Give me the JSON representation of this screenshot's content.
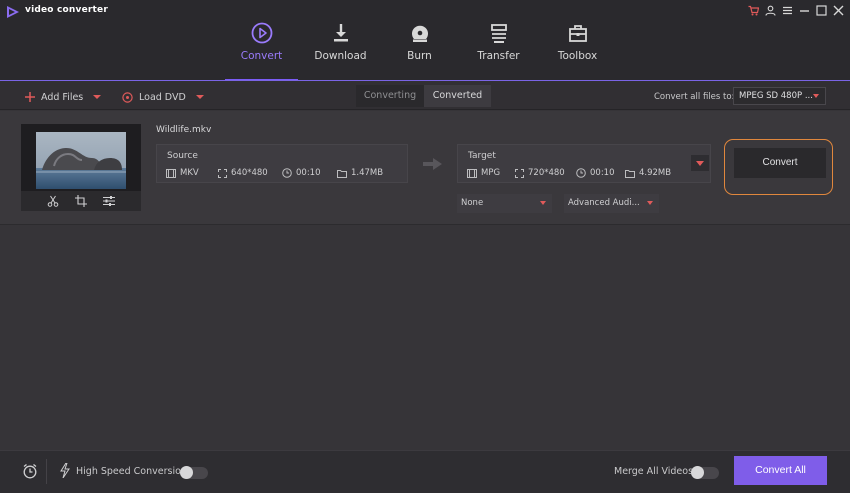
{
  "app": {
    "title": "video converter"
  },
  "nav": {
    "tabs": [
      {
        "label": "Convert",
        "icon": "play-circle-icon",
        "active": true
      },
      {
        "label": "Download",
        "icon": "download-icon",
        "active": false
      },
      {
        "label": "Burn",
        "icon": "disc-icon",
        "active": false
      },
      {
        "label": "Transfer",
        "icon": "transfer-icon",
        "active": false
      },
      {
        "label": "Toolbox",
        "icon": "toolbox-icon",
        "active": false
      }
    ]
  },
  "toolbar": {
    "add_files": "Add Files",
    "load_dvd": "Load DVD",
    "converting": "Converting",
    "converted": "Converted",
    "convert_all_label": "Convert all files to:",
    "format_value": "MPEG SD 480P ..."
  },
  "file": {
    "name": "Wildlife.mkv",
    "source": {
      "header": "Source",
      "format": "MKV",
      "resolution": "640*480",
      "duration": "00:10",
      "size": "1.47MB"
    },
    "target": {
      "header": "Target",
      "format": "MPG",
      "resolution": "720*480",
      "duration": "00:10",
      "size": "4.92MB"
    },
    "subtitle_select": "None",
    "audio_select": "Advanced Audi...",
    "convert_button": "Convert"
  },
  "footer": {
    "high_speed": "High Speed Conversion",
    "high_speed_on": false,
    "merge": "Merge All Videos",
    "merge_on": false,
    "convert_all": "Convert All"
  },
  "colors": {
    "accent": "#7f5de9",
    "highlight_ring": "#e0873d",
    "caret": "#e05a5a"
  }
}
